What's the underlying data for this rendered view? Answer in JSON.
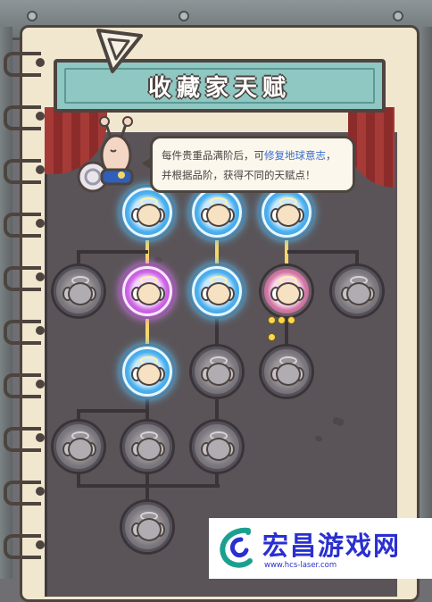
{
  "title": "收藏家天赋",
  "tooltip": {
    "line1_prefix": "每件贵重品满阶后，可",
    "line1_highlight": "修复地球意志",
    "line1_suffix": "，",
    "line2": "并根据品阶，获得不同的天赋点！"
  },
  "talent_nodes": [
    {
      "state": "blue"
    },
    {
      "state": "blue"
    },
    {
      "state": "blue"
    },
    {
      "state": "locked"
    },
    {
      "state": "purple"
    },
    {
      "state": "blue"
    },
    {
      "state": "pink",
      "progress_dots": 4
    },
    {
      "state": "locked"
    },
    {
      "state": "blue"
    },
    {
      "state": "locked"
    },
    {
      "state": "locked"
    },
    {
      "state": "locked"
    },
    {
      "state": "locked"
    },
    {
      "state": "locked"
    },
    {
      "state": "locked"
    }
  ],
  "icons": {
    "nav": "triangle-icon",
    "mascot": "snail-icon",
    "node": "angel-icon"
  },
  "colors": {
    "banner": "#8fc7c2",
    "highlight_text": "#3b6fd2",
    "active_node": "#4fb3ef",
    "special_node": "#cf6ae6"
  },
  "watermark": {
    "title": "宏昌游戏网",
    "url": "www.hcs-laser.com"
  }
}
